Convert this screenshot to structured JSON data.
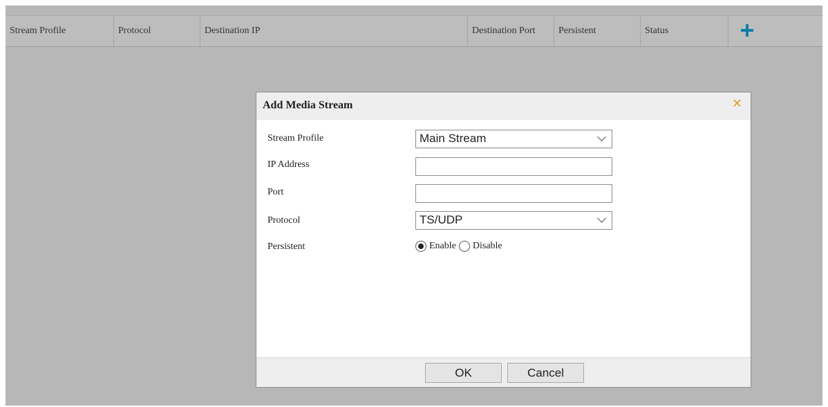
{
  "table": {
    "columns": [
      "Stream Profile",
      "Protocol",
      "Destination IP",
      "Destination Port",
      "Persistent",
      "Status"
    ],
    "add_icon": "plus-icon",
    "accent_color": "#0f7fa8"
  },
  "dialog": {
    "title": "Add Media Stream",
    "close_icon": "close-icon",
    "fields": {
      "stream_profile": {
        "label": "Stream Profile",
        "value": "Main Stream"
      },
      "ip_address": {
        "label": "IP Address",
        "value": ""
      },
      "port": {
        "label": "Port",
        "value": ""
      },
      "protocol": {
        "label": "Protocol",
        "value": "TS/UDP"
      },
      "persistent": {
        "label": "Persistent",
        "options": [
          "Enable",
          "Disable"
        ],
        "selected": "Enable"
      }
    },
    "buttons": {
      "ok": "OK",
      "cancel": "Cancel"
    }
  }
}
